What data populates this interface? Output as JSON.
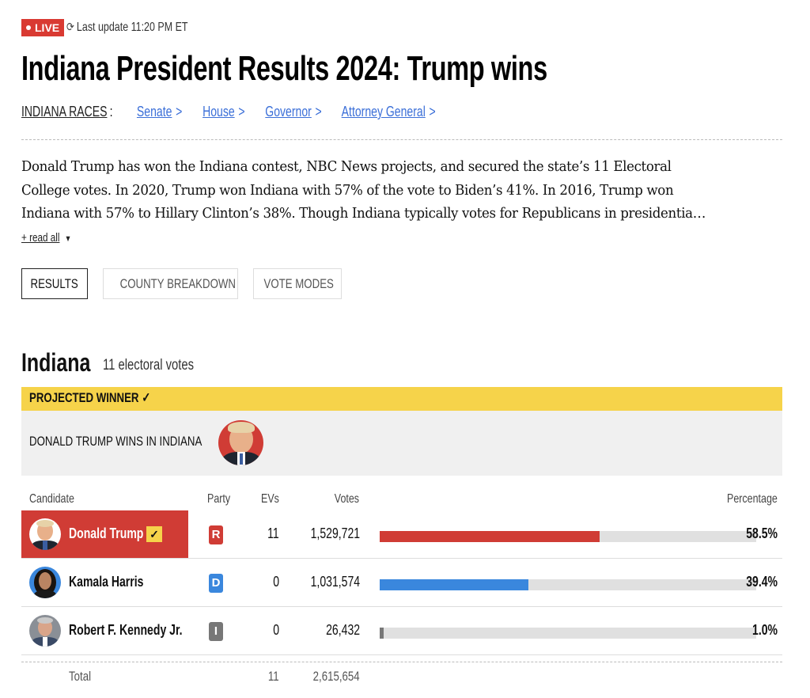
{
  "status": {
    "live_label": "LIVE",
    "refresh_icon": "refresh-icon",
    "last_update": "Last update 11:20 PM ET"
  },
  "page_title": "Indiana President Results 2024: Trump wins",
  "races_nav": {
    "label": "INDIANA RACES",
    "separator": ":",
    "links": [
      {
        "label": "Senate",
        "chevron": ">"
      },
      {
        "label": "House",
        "chevron": ">"
      },
      {
        "label": "Governor",
        "chevron": ">"
      },
      {
        "label": "Attorney General",
        "chevron": ">"
      }
    ]
  },
  "summary": {
    "lines": [
      "Donald Trump has won the Indiana contest, NBC News projects, and secured the state’s 11 Electoral",
      "College votes. In 2020, Trump won Indiana with 57% of the vote to Biden’s 41%. In 2016, Trump won",
      "Indiana with 57% to Hillary Clinton’s 38%. Though Indiana typically votes for Republicans in presidentia…"
    ],
    "read_all": "+ read all",
    "read_all_icon": "caret-down-icon"
  },
  "tabs": [
    {
      "label": "RESULTS",
      "active": true
    },
    {
      "label": "COUNTY BREAKDOWN",
      "active": false
    },
    {
      "label": "VOTE MODES",
      "active": false
    }
  ],
  "state": {
    "name": "Indiana",
    "electoral_votes": "11 electoral votes"
  },
  "winner": {
    "banner": "PROJECTED WINNER ✓",
    "headline": "DONALD TRUMP WINS IN INDIANA"
  },
  "table": {
    "headers": {
      "candidate": "Candidate",
      "party": "Party",
      "evs": "EVs",
      "votes": "Votes",
      "percentage": "Percentage"
    },
    "rows": [
      {
        "name": "Donald Trump",
        "winner": true,
        "check": "✓",
        "party": "R",
        "party_color": "#d03c35",
        "evs": "11",
        "votes": "1,529,721",
        "pct_value": 58.5,
        "pct": "58.5%",
        "bar_color": "#d03c35"
      },
      {
        "name": "Kamala Harris",
        "winner": false,
        "party": "D",
        "party_color": "#3a87dd",
        "evs": "0",
        "votes": "1,031,574",
        "pct_value": 39.4,
        "pct": "39.4%",
        "bar_color": "#3a87dd"
      },
      {
        "name": "Robert F. Kennedy Jr.",
        "winner": false,
        "party": "I",
        "party_color": "#777777",
        "evs": "0",
        "votes": "26,432",
        "pct_value": 1.0,
        "pct": "1.0%",
        "bar_color": "#777777"
      }
    ],
    "total": {
      "label": "Total",
      "evs": "11",
      "votes": "2,615,654"
    }
  },
  "colors": {
    "live": "#d93a32",
    "republican": "#d03c35",
    "democrat": "#3a87dd",
    "independent": "#777777",
    "winner_banner": "#f6d34a",
    "link": "#3b6fd8"
  }
}
